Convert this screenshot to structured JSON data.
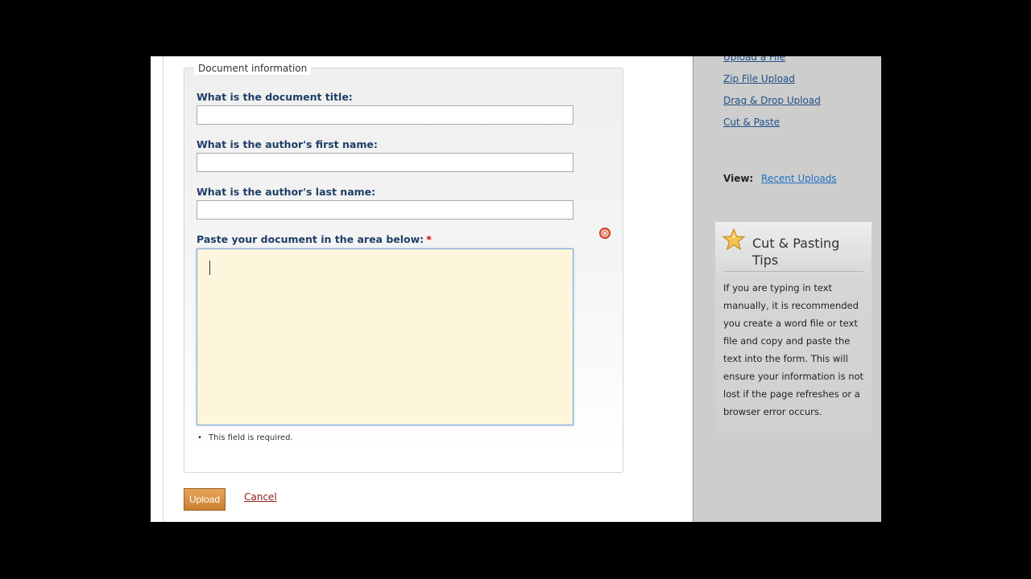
{
  "form": {
    "legend": "Document information",
    "title_label": "What is the document title:",
    "first_name_label": "What is the author's first name:",
    "last_name_label": "What is the author's last name:",
    "paste_label": "Paste your document in the area below:",
    "required_mark": "*",
    "error_bullet": "•",
    "error_text": "This field is required.",
    "title_value": "",
    "first_name_value": "",
    "last_name_value": "",
    "paste_value": ""
  },
  "actions": {
    "upload_label": "Upload",
    "cancel_label": "Cancel"
  },
  "sidebar": {
    "links": [
      {
        "label": "Upload a File"
      },
      {
        "label": "Zip File Upload"
      },
      {
        "label": "Drag & Drop Upload"
      },
      {
        "label": "Cut & Paste"
      }
    ],
    "view_label": "View:",
    "view_link": "Recent Uploads",
    "tips": {
      "icon": "star-icon",
      "title": "Cut & Pasting Tips",
      "body": "If you are typing in text manually, it is recommended you create a word file or text file and copy and paste the text into the form. This will ensure your information is not lost if the page refreshes or a browser error occurs."
    }
  },
  "colors": {
    "label_blue": "#1f3f66",
    "textarea_bg": "#fdf6dc",
    "upload_button": "#d89440",
    "cancel_link": "#8b1a1a",
    "sidebar_bg": "#cdcdcd",
    "clear_icon": "#e8593c"
  }
}
